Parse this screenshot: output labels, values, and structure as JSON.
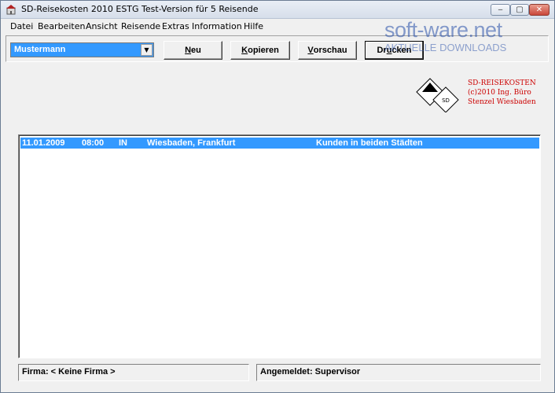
{
  "window": {
    "title": "SD-Reisekosten 2010 ESTG Test-Version für 5 Reisende",
    "controls": {
      "minimize": "‒",
      "maximize": "▢",
      "close": "✕"
    }
  },
  "menu": {
    "items": [
      "Datei",
      "Bearbeiten",
      "Ansicht",
      "Reisende",
      "Extras",
      "Information",
      "Hilfe"
    ]
  },
  "toolbar": {
    "traveler_select": "Mustermann",
    "buttons": {
      "neu": {
        "u": "N",
        "rest": "eu"
      },
      "kopieren": {
        "u": "K",
        "rest": "opieren"
      },
      "vorschau": {
        "u": "V",
        "rest": "orschau"
      },
      "drucken": {
        "pre": "Dr",
        "u": "u",
        "rest": "cken"
      }
    }
  },
  "watermark": {
    "main": "soft-ware.net",
    "sub": "AKTUELLE DOWNLOADS"
  },
  "logo": {
    "badge": "SD",
    "lines": [
      "SD-REISEKOSTEN",
      "(c)2010 Ing. Büro",
      "Stenzel Wiesbaden"
    ]
  },
  "trips": [
    {
      "date": "11.01.2009",
      "time": "08:00",
      "type": "IN",
      "destination": "Wiesbaden, Frankfurt",
      "purpose": "Kunden in beiden Städten"
    }
  ],
  "status": {
    "company": "Firma: < Keine Firma >",
    "login": "Angemeldet: Supervisor"
  },
  "colors": {
    "selection": "#3399ff",
    "logo_text": "#cc0000"
  }
}
